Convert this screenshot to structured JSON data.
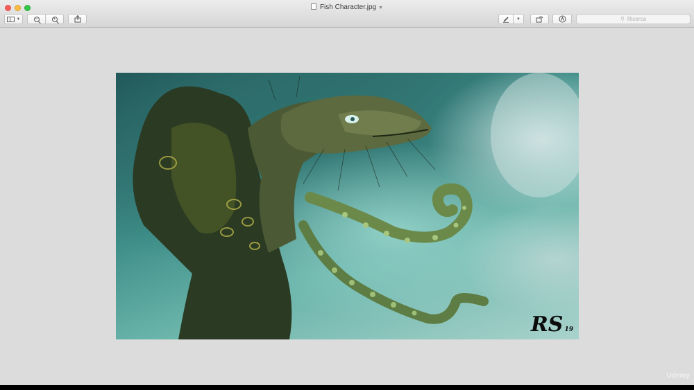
{
  "window": {
    "title": "Fish Character.jpg",
    "title_menu_icon": "chevron-down-icon"
  },
  "toolbar": {
    "sidebar_icon": "sidebar-icon",
    "zoom_out_icon": "zoom-out-icon",
    "zoom_in_icon": "zoom-in-icon",
    "share_icon": "share-icon",
    "markup_icon": "pen-icon",
    "rotate_icon": "rotate-icon",
    "annotate_icon": "markup-toolbar-icon",
    "search_placeholder": "Ricerca"
  },
  "image": {
    "signature_year": "19"
  },
  "watermark": "Udemy",
  "colors": {
    "close": "#fc605b",
    "minimize": "#fdbc40",
    "zoom": "#34c84a",
    "window_bg": "#dcdcdc"
  }
}
